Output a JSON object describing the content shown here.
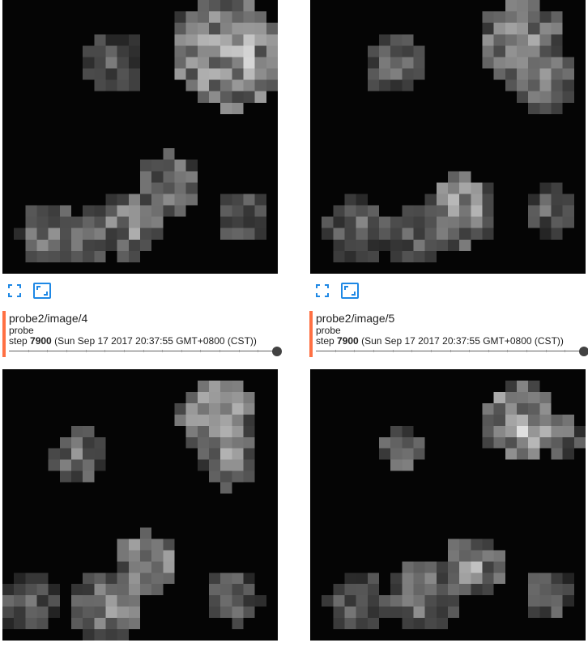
{
  "accent_color": "#ff7043",
  "icon_color": "#1e88e5",
  "cards": [
    {
      "title": "probe2/image/4",
      "run": "probe",
      "step_label": "step",
      "step": "7900",
      "timestamp": "(Sun Sep 17 2017 20:37:55 GMT+0800 (CST))",
      "slider_fraction": 1.0,
      "icons": [
        "fit-to-screen-icon",
        "actual-size-icon"
      ]
    },
    {
      "title": "probe2/image/5",
      "run": "probe",
      "step_label": "step",
      "step": "7900",
      "timestamp": "(Sun Sep 17 2017 20:37:55 GMT+0800 (CST))",
      "slider_fraction": 1.0,
      "icons": [
        "fit-to-screen-icon",
        "actual-size-icon"
      ]
    }
  ],
  "images": [
    {
      "name": "image-top-left",
      "seed": 11,
      "blobs": [
        [
          0.4,
          0.23,
          0.12,
          0.55
        ],
        [
          0.83,
          0.2,
          0.2,
          1.0
        ],
        [
          0.72,
          0.12,
          0.1,
          0.7
        ],
        [
          0.18,
          0.85,
          0.12,
          0.7
        ],
        [
          0.46,
          0.82,
          0.12,
          0.8
        ],
        [
          0.6,
          0.68,
          0.12,
          0.75
        ],
        [
          0.87,
          0.79,
          0.1,
          0.6
        ],
        [
          0.3,
          0.87,
          0.1,
          0.6
        ]
      ]
    },
    {
      "name": "image-top-right",
      "seed": 23,
      "blobs": [
        [
          0.31,
          0.24,
          0.11,
          0.6
        ],
        [
          0.77,
          0.16,
          0.16,
          0.85
        ],
        [
          0.85,
          0.3,
          0.12,
          0.7
        ],
        [
          0.17,
          0.84,
          0.12,
          0.65
        ],
        [
          0.55,
          0.77,
          0.13,
          0.9
        ],
        [
          0.38,
          0.86,
          0.11,
          0.6
        ],
        [
          0.88,
          0.77,
          0.09,
          0.6
        ]
      ]
    },
    {
      "name": "image-bottom-left",
      "seed": 37,
      "blobs": [
        [
          0.28,
          0.32,
          0.1,
          0.7
        ],
        [
          0.78,
          0.17,
          0.14,
          0.9
        ],
        [
          0.82,
          0.33,
          0.11,
          0.75
        ],
        [
          0.09,
          0.86,
          0.11,
          0.6
        ],
        [
          0.38,
          0.88,
          0.13,
          0.8
        ],
        [
          0.52,
          0.72,
          0.12,
          0.9
        ],
        [
          0.84,
          0.84,
          0.1,
          0.65
        ]
      ]
    },
    {
      "name": "image-bottom-right",
      "seed": 53,
      "blobs": [
        [
          0.33,
          0.3,
          0.08,
          0.8
        ],
        [
          0.76,
          0.19,
          0.14,
          1.0
        ],
        [
          0.92,
          0.25,
          0.08,
          0.7
        ],
        [
          0.17,
          0.86,
          0.11,
          0.6
        ],
        [
          0.42,
          0.84,
          0.13,
          0.7
        ],
        [
          0.6,
          0.73,
          0.12,
          0.8
        ],
        [
          0.87,
          0.83,
          0.09,
          0.65
        ]
      ]
    }
  ]
}
